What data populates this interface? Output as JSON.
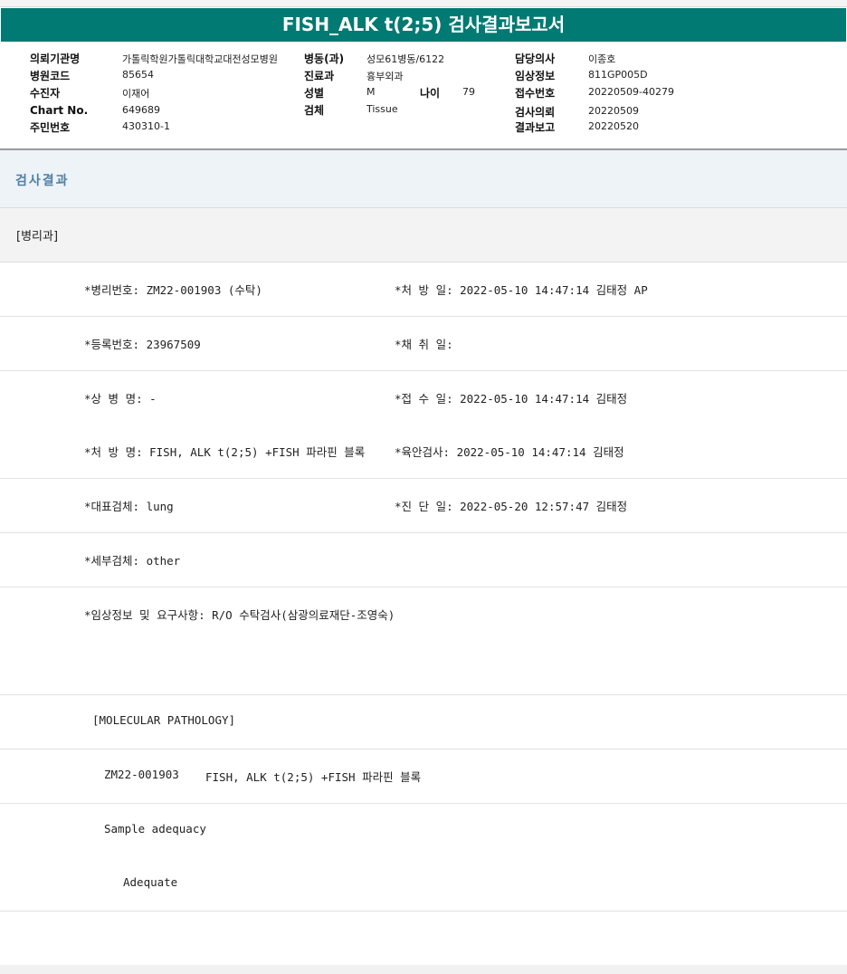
{
  "header": {
    "title": "FISH_ALK t(2;5) 검사결과보고서"
  },
  "info": {
    "institution_label": "의뢰기관명",
    "institution_value": "가톨릭학원가톨릭대학교대전성모병원",
    "ward_label": "병동(과)",
    "ward_value": "성모61병동/6122",
    "doctor_label": "담당의사",
    "doctor_value": "이종호",
    "hospital_code_label": "병원코드",
    "hospital_code_value": "85654",
    "dept_label": "진료과",
    "dept_value": "흉부외과",
    "clinical_info_label": "임상정보",
    "clinical_info_value": "811GP005D",
    "patient_label": "수진자",
    "patient_value": "이재어",
    "sex_label": "성별",
    "sex_value": "M",
    "age_label": "나이",
    "age_value": "79",
    "receipt_no_label": "접수번호",
    "receipt_no_value": "20220509-40279",
    "chart_label": "Chart No.",
    "chart_value": "649689",
    "specimen_label": "검체",
    "specimen_value": "Tissue",
    "request_label": "검사의뢰",
    "request_value": "20220509",
    "resident_label": "주민번호",
    "resident_value": "430310-1",
    "report_label": "결과보고",
    "report_value": "20220520"
  },
  "section": {
    "title": "검사결과",
    "dept_tag": "[병리과]"
  },
  "report": {
    "path_no": "*병리번호: ZM22-001903 (수탁)",
    "prescribe_date": "*처 방 일: 2022-05-10 14:47:14  김태정 AP",
    "reg_no": "*등록번호: 23967509",
    "collect_date": "*채 취 일:",
    "disease": "*상 병 명: -",
    "receipt_date": "*접 수 일: 2022-05-10 14:47:14  김태정",
    "order_name": "*처 방 명: FISH, ALK t(2;5) +FISH 파라핀 블록",
    "gross_date": "*육안검사: 2022-05-10 14:47:14  김태정",
    "main_specimen": "*대표검체: lung",
    "diagnosis_date": "*진 단 일: 2022-05-20 12:57:47  김태정",
    "sub_specimen": "*세부검체: other",
    "clinical_request": "*임상정보 및 요구사항: R/O 수탁검사(삼광의료재단-조영숙)",
    "mol_path": "[MOLECULAR PATHOLOGY]",
    "case_id": "ZM22-001903",
    "case_test": "FISH, ALK t(2;5) +FISH 파라핀 블록",
    "adequacy_label": "Sample adequacy",
    "adequacy_value": "Adequate"
  }
}
